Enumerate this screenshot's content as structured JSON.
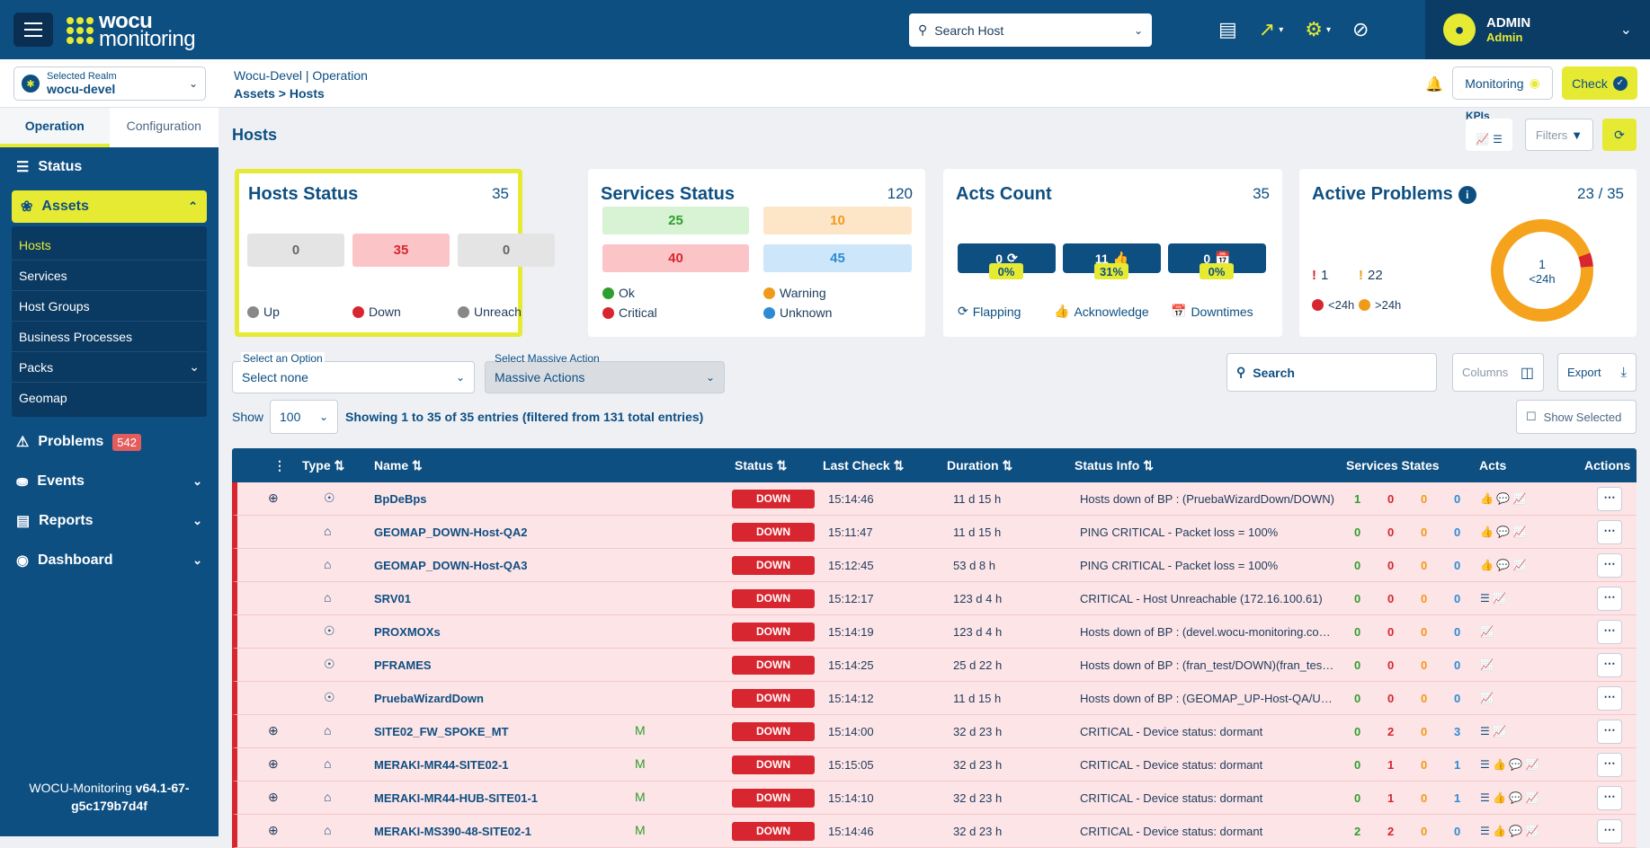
{
  "header": {
    "logo_line1": "wocu",
    "logo_line2": "monitoring",
    "search_placeholder": "Search Host",
    "user": "ADMIN",
    "role": "Admin"
  },
  "subbar": {
    "realm_label": "Selected Realm",
    "realm_value": "wocu-devel",
    "crumb_top": "Wocu-Devel | Operation",
    "crumb_bottom": "Assets > Hosts",
    "monitoring": "Monitoring",
    "check": "Check"
  },
  "sidebar": {
    "tabs": [
      "Operation",
      "Configuration"
    ],
    "status": "Status",
    "assets": "Assets",
    "assets_items": [
      "Hosts",
      "Services",
      "Host Groups",
      "Business Processes",
      "Packs",
      "Geomap"
    ],
    "problems": "Problems",
    "problems_count": "542",
    "events": "Events",
    "reports": "Reports",
    "dashboard": "Dashboard",
    "version_prefix": "WOCU-Monitoring ",
    "version": "v64.1-67-g5c179b7d4f"
  },
  "page": {
    "title": "Hosts",
    "kpis": "KPIs",
    "filters": "Filters"
  },
  "hosts_status": {
    "title": "Hosts Status",
    "total": "35",
    "up": "0",
    "down": "35",
    "unreach": "0",
    "up_label": "Up",
    "down_label": "Down",
    "unreach_label": "Unreach"
  },
  "services_status": {
    "title": "Services Status",
    "total": "120",
    "ok": "25",
    "warning": "10",
    "critical": "40",
    "unknown": "45",
    "ok_label": "Ok",
    "warning_label": "Warning",
    "critical_label": "Critical",
    "unknown_label": "Unknown"
  },
  "acts": {
    "title": "Acts Count",
    "total": "35",
    "flapping": "0",
    "flapping_pct": "0%",
    "ack": "11",
    "ack_pct": "31%",
    "down": "0",
    "down_pct": "0%",
    "flapping_label": "Flapping",
    "ack_label": "Acknowledge",
    "down_label": "Downtimes"
  },
  "problems": {
    "title": "Active Problems",
    "total": "23 / 35",
    "lt24": "1",
    "gt24": "22",
    "lt24_label": "<24h",
    "gt24_label": ">24h",
    "donut_value": "1",
    "donut_label": "<24h",
    "lt24_fraction": 0.043
  },
  "controls": {
    "option_label": "Select an Option",
    "option_value": "Select none",
    "massive_label": "Select Massive Action",
    "massive_value": "Massive Actions",
    "search": "Search",
    "columns": "Columns",
    "export": "Export",
    "show": "Show",
    "show_value": "100",
    "entries": "Showing 1 to 35 of 35 entries (filtered from 131 total entries)",
    "show_selected": "Show Selected"
  },
  "table": {
    "headers": {
      "type": "Type",
      "name": "Name",
      "status": "Status",
      "last_check": "Last Check",
      "duration": "Duration",
      "status_info": "Status Info",
      "services_states": "Services States",
      "acts": "Acts",
      "actions": "Actions"
    },
    "rows": [
      {
        "plus": true,
        "type": "bp",
        "name": "BpDeBps",
        "m": "",
        "status": "DOWN",
        "last": "15:14:46",
        "dur": "11 d 15 h",
        "info": "Hosts down of BP : (PruebaWizardDown/DOWN)",
        "s": [
          "1",
          "0",
          "0",
          "0"
        ],
        "acts": "👍 💬 📈"
      },
      {
        "plus": false,
        "type": "host",
        "name": "GEOMAP_DOWN-Host-QA2",
        "m": "",
        "status": "DOWN",
        "last": "15:11:47",
        "dur": "11 d 15 h",
        "info": "PING CRITICAL - Packet loss = 100%",
        "s": [
          "0",
          "0",
          "0",
          "0"
        ],
        "acts": "👍 💬 📈"
      },
      {
        "plus": false,
        "type": "host",
        "name": "GEOMAP_DOWN-Host-QA3",
        "m": "",
        "status": "DOWN",
        "last": "15:12:45",
        "dur": "53 d 8 h",
        "info": "PING CRITICAL - Packet loss = 100%",
        "s": [
          "0",
          "0",
          "0",
          "0"
        ],
        "acts": "👍 💬 📈"
      },
      {
        "plus": false,
        "type": "host",
        "name": "SRV01",
        "m": "",
        "status": "DOWN",
        "last": "15:12:17",
        "dur": "123 d 4 h",
        "info": "CRITICAL - Host Unreachable (172.16.100.61)",
        "s": [
          "0",
          "0",
          "0",
          "0"
        ],
        "acts": "☰ 📈"
      },
      {
        "plus": false,
        "type": "bp",
        "name": "PROXMOXs",
        "m": "",
        "status": "DOWN",
        "last": "15:14:19",
        "dur": "123 d 4 h",
        "info": "Hosts down of BP : (devel.wocu-monitoring.co…",
        "s": [
          "0",
          "0",
          "0",
          "0"
        ],
        "acts": "📈"
      },
      {
        "plus": false,
        "type": "bp",
        "name": "PFRAMES",
        "m": "",
        "status": "DOWN",
        "last": "15:14:25",
        "dur": "25 d 22 h",
        "info": "Hosts down of BP : (fran_test/DOWN)(fran_tes…",
        "s": [
          "0",
          "0",
          "0",
          "0"
        ],
        "acts": "📈"
      },
      {
        "plus": false,
        "type": "bp",
        "name": "PruebaWizardDown",
        "m": "",
        "status": "DOWN",
        "last": "15:14:12",
        "dur": "11 d 15 h",
        "info": "Hosts down of BP : (GEOMAP_UP-Host-QA/U…",
        "s": [
          "0",
          "0",
          "0",
          "0"
        ],
        "acts": "📈"
      },
      {
        "plus": true,
        "type": "host",
        "name": "SITE02_FW_SPOKE_MT",
        "m": "M",
        "status": "DOWN",
        "last": "15:14:00",
        "dur": "32 d 23 h",
        "info": "CRITICAL - Device status: dormant",
        "s": [
          "0",
          "2",
          "0",
          "3"
        ],
        "acts": "☰ 📈"
      },
      {
        "plus": true,
        "type": "host",
        "name": "MERAKI-MR44-SITE02-1",
        "m": "M",
        "status": "DOWN",
        "last": "15:15:05",
        "dur": "32 d 23 h",
        "info": "CRITICAL - Device status: dormant",
        "s": [
          "0",
          "1",
          "0",
          "1"
        ],
        "acts": "☰ 👍 💬 📈"
      },
      {
        "plus": true,
        "type": "host",
        "name": "MERAKI-MR44-HUB-SITE01-1",
        "m": "M",
        "status": "DOWN",
        "last": "15:14:10",
        "dur": "32 d 23 h",
        "info": "CRITICAL - Device status: dormant",
        "s": [
          "0",
          "1",
          "0",
          "1"
        ],
        "acts": "☰ 👍 💬 📈"
      },
      {
        "plus": true,
        "type": "host",
        "name": "MERAKI-MS390-48-SITE02-1",
        "m": "M",
        "status": "DOWN",
        "last": "15:14:46",
        "dur": "32 d 23 h",
        "info": "CRITICAL - Device status: dormant",
        "s": [
          "2",
          "2",
          "0",
          "0"
        ],
        "acts": "☰ 👍 💬 📈"
      }
    ]
  }
}
